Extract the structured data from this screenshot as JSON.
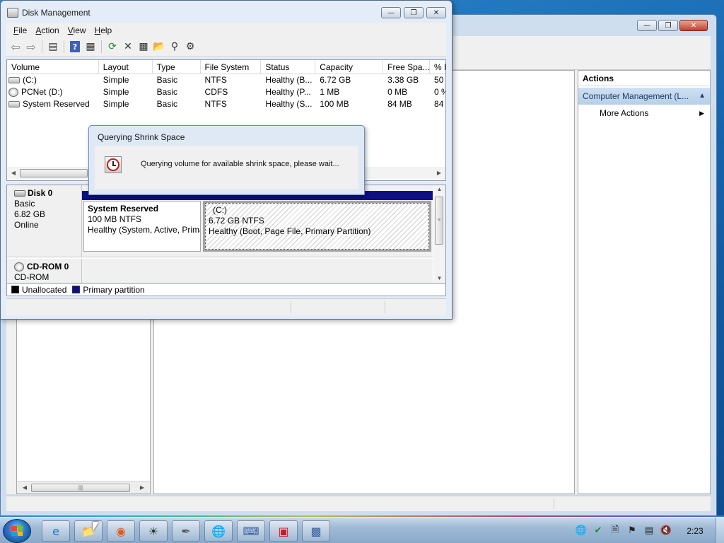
{
  "disk_management": {
    "title": "Disk Management",
    "menu": [
      "File",
      "Action",
      "View",
      "Help"
    ],
    "volume_list": {
      "columns": [
        "Volume",
        "Layout",
        "Type",
        "File System",
        "Status",
        "Capacity",
        "Free Spa...",
        "% F"
      ],
      "rows": [
        {
          "icon": "drive-icon",
          "cells": [
            " (C:)",
            "Simple",
            "Basic",
            "NTFS",
            "Healthy (B...",
            "6.72 GB",
            "3.38 GB",
            "50"
          ]
        },
        {
          "icon": "cd-drive-icon",
          "cells": [
            "PCNet (D:)",
            "Simple",
            "Basic",
            "CDFS",
            "Healthy (P...",
            "1 MB",
            "0 MB",
            "0 %"
          ]
        },
        {
          "icon": "drive-icon",
          "cells": [
            "System Reserved",
            "Simple",
            "Basic",
            "NTFS",
            "Healthy (S...",
            "100 MB",
            "84 MB",
            "84"
          ]
        }
      ]
    },
    "disks": [
      {
        "name": "Disk 0",
        "type": "Basic",
        "size": "6.82 GB",
        "state": "Online",
        "partitions": [
          {
            "title": "System Reserved",
            "size": "100 MB NTFS",
            "status": "Healthy (System, Active, Primary Partition)"
          },
          {
            "title": "(C:)",
            "size": "6.72 GB NTFS",
            "status": "Healthy (Boot, Page File, Primary Partition)"
          }
        ]
      },
      {
        "name": "CD-ROM 0",
        "type": "CD-ROM"
      }
    ],
    "legend": [
      {
        "label": "Unallocated",
        "color": "#000000"
      },
      {
        "label": "Primary partition",
        "color": "#0e0e85"
      }
    ]
  },
  "query_dialog": {
    "title": "Querying Shrink Space",
    "message": "Querying volume for available shrink space, please wait..."
  },
  "computer_management": {
    "actions_header": "Actions",
    "actions_group": "Computer Management (L...",
    "more_actions": "More Actions"
  },
  "taskbar": {
    "clock": "2:23",
    "apps": [
      "internet-explorer-icon",
      "windows-explorer-icon",
      "firefox-icon",
      "app-icon",
      "eraser-icon",
      "network-globe-icon",
      "computer-management-icon",
      "toolbox-icon",
      "disk-management-icon"
    ]
  },
  "colors": {
    "primary_partition": "#0e0e85",
    "unallocated": "#000000",
    "actions_group_text": "#1a3d6b"
  }
}
